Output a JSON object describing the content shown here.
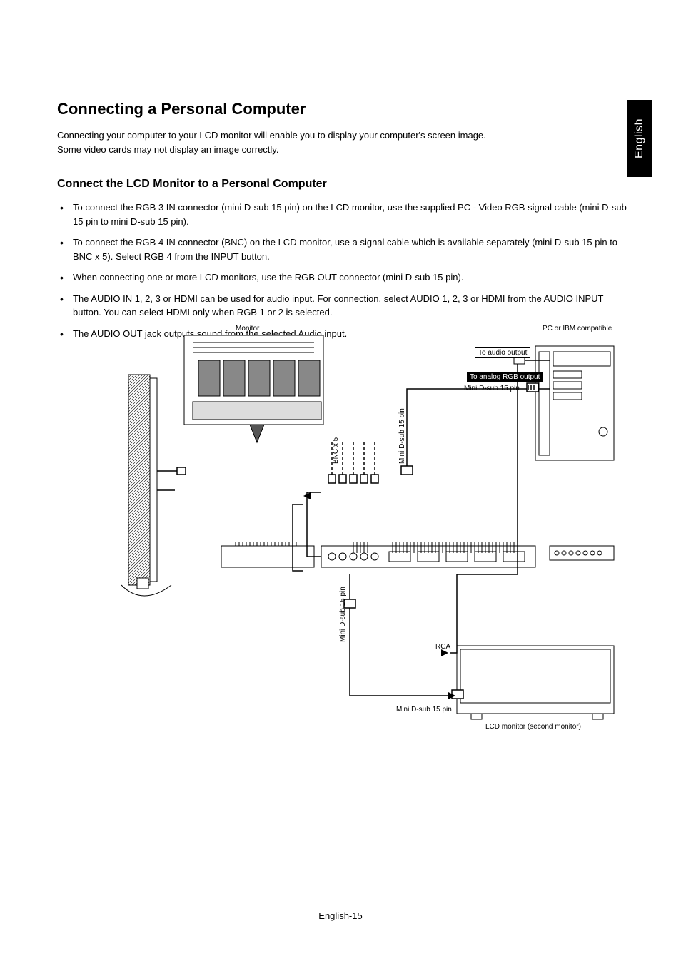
{
  "sideTab": "English",
  "title": "Connecting a Personal Computer",
  "intro1": "Connecting your computer to your LCD monitor will enable you to display your computer's screen image.",
  "intro2": "Some video cards may not display an image correctly.",
  "subheading": "Connect the LCD Monitor to a Personal Computer",
  "bullets": [
    "To connect the RGB 3 IN connector (mini D-sub 15 pin) on the LCD monitor, use the supplied PC - Video RGB signal cable (mini D-sub 15 pin to mini D-sub 15 pin).",
    "To connect the RGB 4 IN connector (BNC) on the LCD monitor, use a signal cable which is available separately (mini D-sub 15 pin to BNC x 5).  Select RGB 4 from the INPUT button.",
    "When connecting one or more LCD monitors, use the RGB OUT connector (mini D-sub 15 pin).",
    "The AUDIO IN 1, 2, 3 or HDMI can be used for audio input. For connection, select AUDIO 1, 2, 3 or HDMI from the AUDIO INPUT button.  You can select HDMI only when RGB 1 or 2 is selected.",
    "The AUDIO OUT jack outputs sound from the selected Audio input."
  ],
  "labels": {
    "monitor": "Monitor",
    "pc": "PC or IBM compatible",
    "toAudioOut": "To audio output",
    "toAnalogRGB": "To analog RGB output",
    "miniDsub15a": "Mini D-sub 15 pin",
    "miniDsub15b": "Mini D-sub 15 pin",
    "miniDsub15c": "Mini D-sub 15 pin",
    "miniDsub15d": "Mini D-sub 15 pin",
    "bncx5": "BNC x 5",
    "rca": "RCA",
    "secondMonitor": "LCD monitor (second monitor)"
  },
  "footer": "English-15"
}
